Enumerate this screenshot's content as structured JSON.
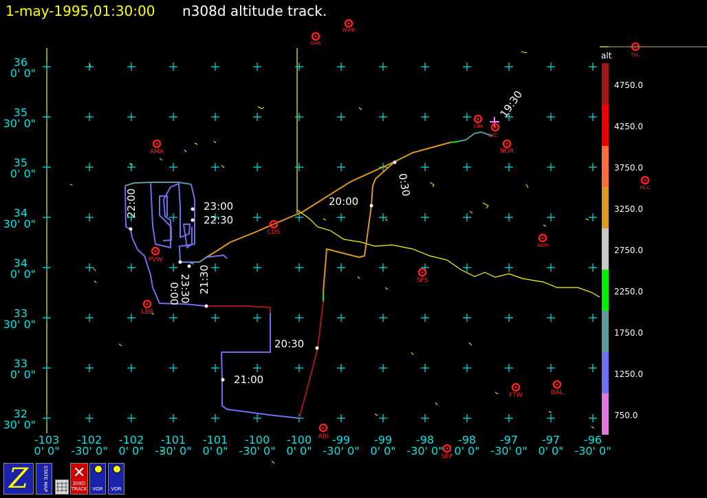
{
  "title": {
    "date": "1-may-1995,01:30:00",
    "text": "n308d altitude track."
  },
  "legend": {
    "header": "alt",
    "labels": [
      "4750.0",
      "4250.0",
      "3750.0",
      "3250.0",
      "2750.0",
      "2250.0",
      "1750.0",
      "1250.0",
      "750.0"
    ],
    "colors": [
      "#a01818",
      "#ee0000",
      "#ff6a3a",
      "#dd9a22",
      "#c8c8c8",
      "#00ee00",
      "#5f9a9a",
      "#7070ee",
      "#dd77dd"
    ]
  },
  "axes": {
    "lon_labels": [
      [
        "-103",
        "0' 0\""
      ],
      [
        "-102",
        "-30' 0\""
      ],
      [
        "-102",
        "0' 0\""
      ],
      [
        "-101",
        "-30' 0\""
      ],
      [
        "-101",
        "0' 0\""
      ],
      [
        "-100",
        "-30' 0\""
      ],
      [
        "-100",
        "0' 0\""
      ],
      [
        "-99",
        "-30' 0\""
      ],
      [
        "-99",
        "0' 0\""
      ],
      [
        "-98",
        "-30' 0\""
      ],
      [
        "-98",
        "0' 0\""
      ],
      [
        "-97",
        "-30' 0\""
      ],
      [
        "-97",
        "0' 0\""
      ],
      [
        "-96",
        "-30' 0\""
      ]
    ],
    "lat_labels": [
      [
        "36",
        "0' 0\""
      ],
      [
        "35",
        "30' 0\""
      ],
      [
        "35",
        "0' 0\""
      ],
      [
        "34",
        "30' 0\""
      ],
      [
        "34",
        "0' 0\""
      ],
      [
        "33",
        "30' 0\""
      ],
      [
        "33",
        "0' 0\""
      ],
      [
        "32",
        "30' 0\""
      ]
    ]
  },
  "stations": [
    "TUL",
    "WWR",
    "GAG",
    "CIM",
    "OKC",
    "NOR",
    "AMA",
    "MLC",
    "CDS",
    "ADM",
    "PVW",
    "SPS",
    "LBB",
    "FTW",
    "DAL",
    "ABI",
    "SEP"
  ],
  "time_labels": [
    "19:30",
    "20:00",
    "20:30",
    "21:00",
    "21:30",
    "22:00",
    "22:30",
    "23:00",
    "23:30",
    "0:00",
    "0:30"
  ],
  "toolbar": {
    "z_label": "Z",
    "state_map_label": "STATE MAP",
    "track_label": "308D TRACK",
    "vor1_label": "VOR",
    "vor2_label": "VOR"
  }
}
